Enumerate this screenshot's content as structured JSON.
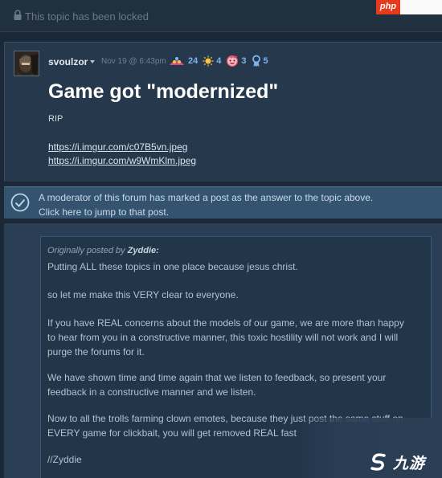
{
  "locked_bar": {
    "text": "This topic has been locked"
  },
  "corner_badge": {
    "text": "php"
  },
  "post": {
    "author": "svoulzor",
    "timestamp": "Nov 19 @ 6:43pm",
    "awards": [
      {
        "icon": "wholesome-award-icon",
        "count": "24"
      },
      {
        "icon": "sun-award-icon",
        "count": "4"
      },
      {
        "icon": "laugh-face-award-icon",
        "count": "3"
      },
      {
        "icon": "ribbon-award-icon",
        "count": "5"
      }
    ],
    "title": "Game got \"modernized\"",
    "body": "RIP",
    "links": [
      "https://i.imgur.com/c07B5vn.jpeg",
      "https://i.imgur.com/w9WmKlm.jpeg"
    ]
  },
  "moderator_banner": {
    "line1": "A moderator of this forum has marked a post as the answer to the topic above.",
    "line2": "Click here to jump to that post."
  },
  "quote": {
    "origin_prefix": "Originally posted by",
    "origin_author": "Zyddie:",
    "lines": [
      "Putting ALL these topics in one place because jesus christ.",
      "so let me make this VERY clear to everyone.",
      "If you have REAL concerns about the models of our game, we are more than happy",
      "to hear from you in a constructive manner, this toxic hostility will not work and I will",
      "purge the forums for it.",
      "We have shown time and time again that we listen to feedback, so present your",
      "feedback in a constructive manner and we listen.",
      "Now to all the trolls farming clown emotes, because they just post the same stuff on",
      "EVERY game for clickbait, you will get removed REAL fast",
      "//Zyddie"
    ]
  },
  "watermark": {
    "text": "九游"
  }
}
